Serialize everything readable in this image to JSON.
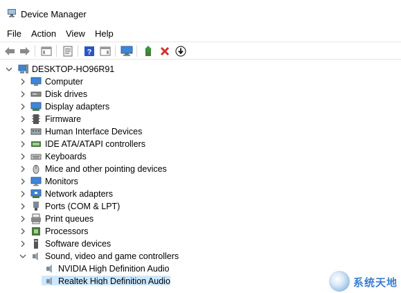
{
  "window": {
    "title": "Device Manager"
  },
  "menu": [
    "File",
    "Action",
    "View",
    "Help"
  ],
  "toolbar": {
    "buttons": [
      "back-icon",
      "forward-icon",
      "show-hide-tree-icon",
      "properties-icon",
      "help-icon",
      "action-pane-icon",
      "monitor-icon",
      "update-driver-icon",
      "uninstall-icon",
      "download-icon"
    ]
  },
  "tree": {
    "root": "DESKTOP-HO96R91",
    "categories": [
      "Computer",
      "Disk drives",
      "Display adapters",
      "Firmware",
      "Human Interface Devices",
      "IDE ATA/ATAPI controllers",
      "Keyboards",
      "Mice and other pointing devices",
      "Monitors",
      "Network adapters",
      "Ports (COM & LPT)",
      "Print queues",
      "Processors",
      "Software devices",
      "Sound, video and game controllers"
    ],
    "sound_children": [
      "NVIDIA High Definition Audio",
      "Realtek High Definition Audio"
    ]
  },
  "watermark": {
    "text": "系统天地"
  },
  "colors": {
    "selection": "#cce8ff",
    "uninstall": "#d32f2f",
    "update": "#2e7d32"
  }
}
